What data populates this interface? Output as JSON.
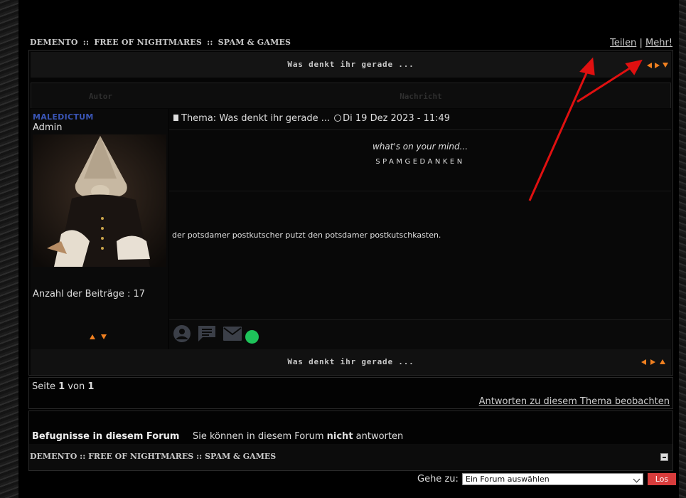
{
  "forum": {
    "breadcrumb": [
      "DEMENTO",
      "FREE OF NIGHTMARES",
      "SPAM & GAMES"
    ],
    "breadcrumb_sep": "::",
    "share_label": "Teilen",
    "more_label": "Mehr!",
    "share_sep": "|"
  },
  "topic": {
    "title": "Was denkt ihr gerade ...",
    "col_author": "Autor",
    "col_message": "Nachricht"
  },
  "post": {
    "author_name": "MALEDICTUM",
    "author_role": "Admin",
    "post_count_label": "Anzahl der Beiträge",
    "post_count_sep": ":",
    "post_count": "17",
    "subject": "Thema: Was denkt ihr gerade ...",
    "date": "Di 19 Dez 2023 - 11:49",
    "tagline": "what's on your mind...",
    "heading": "SPAMGEDANKEN",
    "body": "der potsdamer postkutscher putzt den potsdamer postkutschkasten."
  },
  "pagination": {
    "prefix": "Seite",
    "current": "1",
    "of": "von",
    "total": "1",
    "watch_label": "Antworten zu diesem Thema beobachten"
  },
  "permissions": {
    "label": "Befugnisse in diesem Forum",
    "text_before": "Sie können in diesem Forum",
    "text_bold": "nicht",
    "text_after": "antworten"
  },
  "jump": {
    "label": "Gehe zu:",
    "selected": "Ein Forum auswählen",
    "button": "Los"
  },
  "colors": {
    "accent_orange": "#f08020",
    "author_blue": "#3a55b5",
    "online_green": "#1ec35a",
    "button_red": "#d83c3c",
    "annotation_red": "#e01010"
  }
}
